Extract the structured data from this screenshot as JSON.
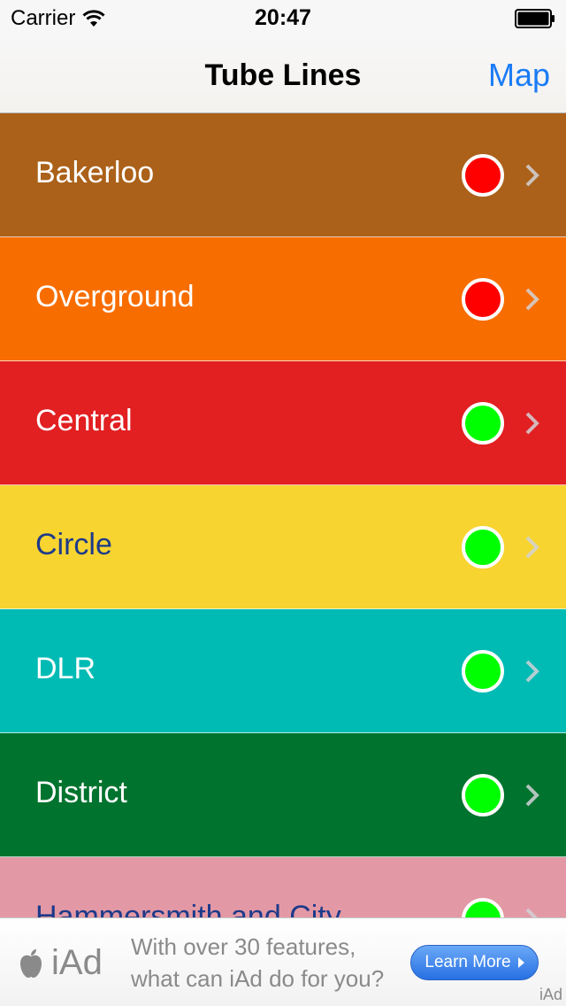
{
  "status_bar": {
    "carrier": "Carrier",
    "time": "20:47",
    "wifi_icon": "wifi-icon",
    "battery_icon": "battery-icon"
  },
  "nav": {
    "title": "Tube Lines",
    "right_button": "Map"
  },
  "colors": {
    "status_red": "#ff0000",
    "status_green": "#00ff00",
    "nav_tint": "#1a7cf5"
  },
  "lines": [
    {
      "name": "Bakerloo",
      "bg": "#ab6119",
      "text_color": "#ffffff",
      "status": "red",
      "status_color": "#ff0000"
    },
    {
      "name": "Overground",
      "bg": "#f86d00",
      "text_color": "#ffffff",
      "status": "red",
      "status_color": "#ff0000"
    },
    {
      "name": "Central",
      "bg": "#e21f21",
      "text_color": "#ffffff",
      "status": "green",
      "status_color": "#00ff00"
    },
    {
      "name": "Circle",
      "bg": "#f7d42f",
      "text_color": "#1d3a8a",
      "status": "green",
      "status_color": "#00ff00"
    },
    {
      "name": "DLR",
      "bg": "#00bbb4",
      "text_color": "#ffffff",
      "status": "green",
      "status_color": "#00ff00"
    },
    {
      "name": "District",
      "bg": "#00732e",
      "text_color": "#ffffff",
      "status": "green",
      "status_color": "#00ff00"
    },
    {
      "name": "Hammersmith and City",
      "bg": "#e399a5",
      "text_color": "#1d3a8a",
      "status": "green",
      "status_color": "#00ff00"
    }
  ],
  "ad": {
    "logo_icon": "apple-icon",
    "brand": "iAd",
    "line1": "With over 30 features,",
    "line2": "what can iAd do for you?",
    "button": "Learn More",
    "corner": "iAd"
  }
}
